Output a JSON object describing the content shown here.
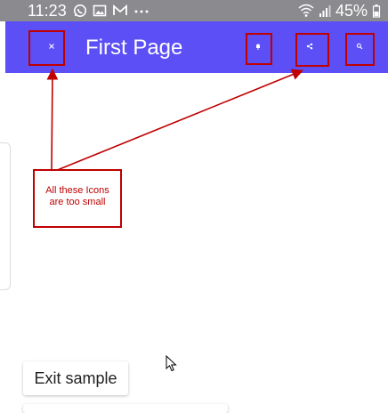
{
  "status_bar": {
    "time": "11:23",
    "battery": "45%",
    "icons": [
      "whatsapp-icon",
      "gallery-icon",
      "gmail-icon",
      "more-dots-icon",
      "wifi-icon",
      "signal-icon",
      "battery-icon"
    ]
  },
  "app_bar": {
    "title": "First Page",
    "leading_icon": "close-icon",
    "action_icons": [
      "notification-bell-icon",
      "share-icon",
      "search-icon"
    ],
    "color": "#5b4ff5"
  },
  "annotation": {
    "text_line1": "All these Icons",
    "text_line2": "are too small",
    "color": "#c00000"
  },
  "main": {
    "exit_button_label": "Exit sample"
  }
}
